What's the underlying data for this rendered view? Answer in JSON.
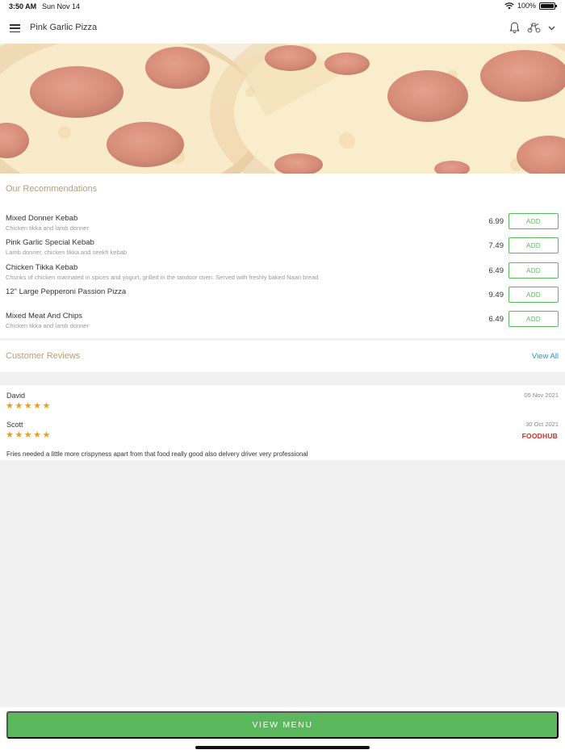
{
  "status_bar": {
    "time": "3:50 AM",
    "date": "Sun Nov 14",
    "battery": "100%"
  },
  "header": {
    "title": "Pink Garlic Pizza"
  },
  "recommendations": {
    "title": "Our Recommendations",
    "items": [
      {
        "name": "Mixed Donner Kebab",
        "description": "Chicken tikka and lamb donner",
        "price": "6.99",
        "add_label": "ADD"
      },
      {
        "name": "Pink Garlic Special Kebab",
        "description": "Lamb donner, chicken tikka and seekh kebab",
        "price": "7.49",
        "add_label": "ADD"
      },
      {
        "name": "Chicken Tikka Kebab",
        "description": "Chunks of chicken marinated in spices and yogurt, grilled in the tandoor oven. Served with freshly baked Naan bread",
        "price": "6.49",
        "add_label": "ADD"
      },
      {
        "name": "12\" Large Pepperoni Passion Pizza",
        "description": "",
        "price": "9.49",
        "add_label": "ADD"
      },
      {
        "name": "Mixed Meat And Chips",
        "description": "Chicken tikka and lamb donner",
        "price": "6.49",
        "add_label": "ADD"
      }
    ]
  },
  "reviews": {
    "title": "Customer Reviews",
    "view_all_label": "View All",
    "items": [
      {
        "author": "David",
        "date": "05 Nov 2021",
        "rating": 5,
        "comment": "",
        "source": ""
      },
      {
        "author": "Scott",
        "date": "30 Oct 2021",
        "rating": 5,
        "comment": "Fries needed a little more crispyness apart from that food really good also delvery driver very professional",
        "source": "FOODHUB"
      }
    ]
  },
  "footer": {
    "view_menu_label": "VIEW MENU"
  },
  "colors": {
    "accent_green": "#5cb85c",
    "section_title": "#b59d7a",
    "link_blue": "#2d8fc2",
    "star": "#f39c12",
    "brand_red": "#d62b24"
  },
  "icons": [
    "menu-icon",
    "bell-icon",
    "delivery-scooter-icon",
    "chevron-down-icon",
    "wifi-icon",
    "battery-icon",
    "star-icon"
  ]
}
